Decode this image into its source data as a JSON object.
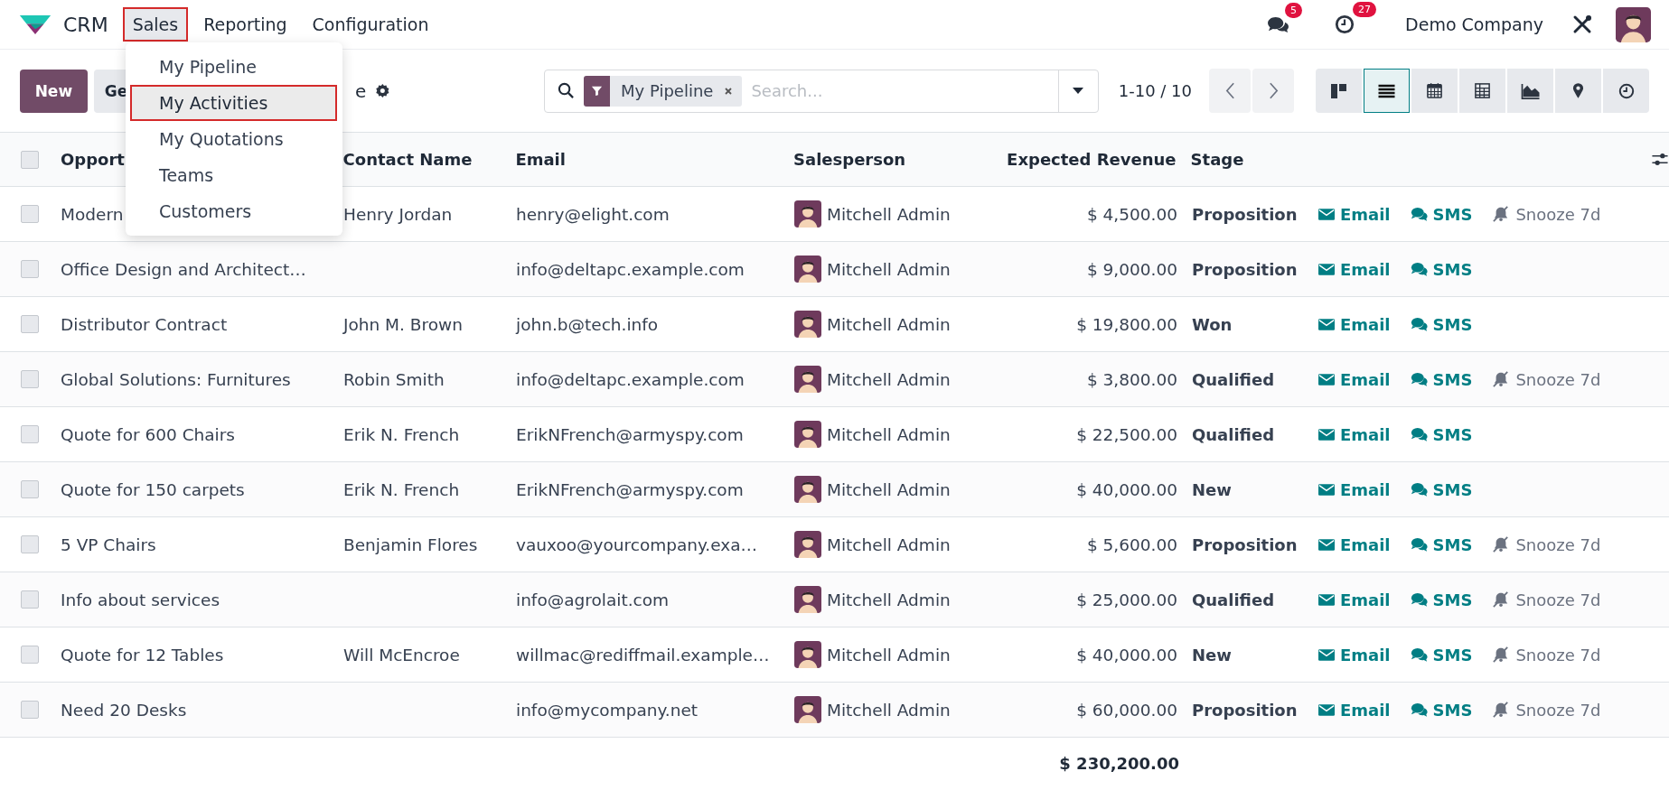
{
  "navbar": {
    "app_name": "CRM",
    "menus": [
      {
        "label": "Sales",
        "selected": true
      },
      {
        "label": "Reporting",
        "selected": false
      },
      {
        "label": "Configuration",
        "selected": false
      }
    ],
    "messages_badge": "5",
    "activities_badge": "27",
    "company": "Demo Company"
  },
  "sales_menu": {
    "items": [
      {
        "label": "My Pipeline",
        "selected": false
      },
      {
        "label": "My Activities",
        "selected": true
      },
      {
        "label": "My Quotations",
        "selected": false
      },
      {
        "label": "Teams",
        "selected": false
      },
      {
        "label": "Customers",
        "selected": false
      }
    ]
  },
  "control_panel": {
    "new_button": "New",
    "second_button": "Ge",
    "breadcrumb": "e",
    "search": {
      "facet": "My Pipeline",
      "placeholder": "Search..."
    },
    "pager": "1-10 / 10",
    "views": [
      {
        "kind": "kanban",
        "selected": false
      },
      {
        "kind": "list",
        "selected": true
      },
      {
        "kind": "calendar",
        "selected": false
      },
      {
        "kind": "pivot",
        "selected": false
      },
      {
        "kind": "graph",
        "selected": false
      },
      {
        "kind": "map",
        "selected": false
      },
      {
        "kind": "activity",
        "selected": false
      }
    ]
  },
  "table": {
    "select_all_checked": false,
    "columns": [
      "Opport",
      "Contact Name",
      "Email",
      "Salesperson",
      "Expected Revenue",
      "Stage"
    ],
    "rows": [
      {
        "checked": false,
        "opportunity": "Modern",
        "contact": "Henry Jordan",
        "email": "henry@elight.com",
        "salesperson": "Mitchell Admin",
        "revenue": "$ 4,500.00",
        "stage": "Proposition",
        "actions": [
          {
            "kind": "email",
            "label": "Email"
          },
          {
            "kind": "sms",
            "label": "SMS"
          },
          {
            "kind": "snooze",
            "label": "Snooze 7d"
          }
        ]
      },
      {
        "checked": false,
        "opportunity": "Office Design and Architect…",
        "contact": "",
        "email": "info@deltapc.example.com",
        "salesperson": "Mitchell Admin",
        "revenue": "$ 9,000.00",
        "stage": "Proposition",
        "actions": [
          {
            "kind": "email",
            "label": "Email"
          },
          {
            "kind": "sms",
            "label": "SMS"
          }
        ]
      },
      {
        "checked": false,
        "opportunity": "Distributor Contract",
        "contact": "John M. Brown",
        "email": "john.b@tech.info",
        "salesperson": "Mitchell Admin",
        "revenue": "$ 19,800.00",
        "stage": "Won",
        "actions": [
          {
            "kind": "email",
            "label": "Email"
          },
          {
            "kind": "sms",
            "label": "SMS"
          }
        ]
      },
      {
        "checked": false,
        "opportunity": "Global Solutions: Furnitures",
        "contact": "Robin Smith",
        "email": "info@deltapc.example.com",
        "salesperson": "Mitchell Admin",
        "revenue": "$ 3,800.00",
        "stage": "Qualified",
        "actions": [
          {
            "kind": "email",
            "label": "Email"
          },
          {
            "kind": "sms",
            "label": "SMS"
          },
          {
            "kind": "snooze",
            "label": "Snooze 7d"
          }
        ]
      },
      {
        "checked": false,
        "opportunity": "Quote for 600 Chairs",
        "contact": "Erik N. French",
        "email": "ErikNFrench@armyspy.com",
        "salesperson": "Mitchell Admin",
        "revenue": "$ 22,500.00",
        "stage": "Qualified",
        "actions": [
          {
            "kind": "email",
            "label": "Email"
          },
          {
            "kind": "sms",
            "label": "SMS"
          }
        ]
      },
      {
        "checked": false,
        "opportunity": "Quote for 150 carpets",
        "contact": "Erik N. French",
        "email": "ErikNFrench@armyspy.com",
        "salesperson": "Mitchell Admin",
        "revenue": "$ 40,000.00",
        "stage": "New",
        "actions": [
          {
            "kind": "email",
            "label": "Email"
          },
          {
            "kind": "sms",
            "label": "SMS"
          }
        ]
      },
      {
        "checked": false,
        "opportunity": "5 VP Chairs",
        "contact": "Benjamin Flores",
        "email": "vauxoo@yourcompany.exa…",
        "salesperson": "Mitchell Admin",
        "revenue": "$ 5,600.00",
        "stage": "Proposition",
        "actions": [
          {
            "kind": "email",
            "label": "Email"
          },
          {
            "kind": "sms",
            "label": "SMS"
          },
          {
            "kind": "snooze",
            "label": "Snooze 7d"
          }
        ]
      },
      {
        "checked": false,
        "opportunity": "Info about services",
        "contact": "",
        "email": "info@agrolait.com",
        "salesperson": "Mitchell Admin",
        "revenue": "$ 25,000.00",
        "stage": "Qualified",
        "actions": [
          {
            "kind": "email",
            "label": "Email"
          },
          {
            "kind": "sms",
            "label": "SMS"
          },
          {
            "kind": "snooze",
            "label": "Snooze 7d"
          }
        ]
      },
      {
        "checked": false,
        "opportunity": "Quote for 12 Tables",
        "contact": "Will McEncroe",
        "email": "willmac@rediffmail.example…",
        "salesperson": "Mitchell Admin",
        "revenue": "$ 40,000.00",
        "stage": "New",
        "actions": [
          {
            "kind": "email",
            "label": "Email"
          },
          {
            "kind": "sms",
            "label": "SMS"
          },
          {
            "kind": "snooze",
            "label": "Snooze 7d"
          }
        ]
      },
      {
        "checked": false,
        "opportunity": "Need 20 Desks",
        "contact": "",
        "email": "info@mycompany.net",
        "salesperson": "Mitchell Admin",
        "revenue": "$ 60,000.00",
        "stage": "Proposition",
        "actions": [
          {
            "kind": "email",
            "label": "Email"
          },
          {
            "kind": "sms",
            "label": "SMS"
          },
          {
            "kind": "snooze",
            "label": "Snooze 7d"
          }
        ]
      }
    ],
    "total": "$ 230,200.00"
  }
}
